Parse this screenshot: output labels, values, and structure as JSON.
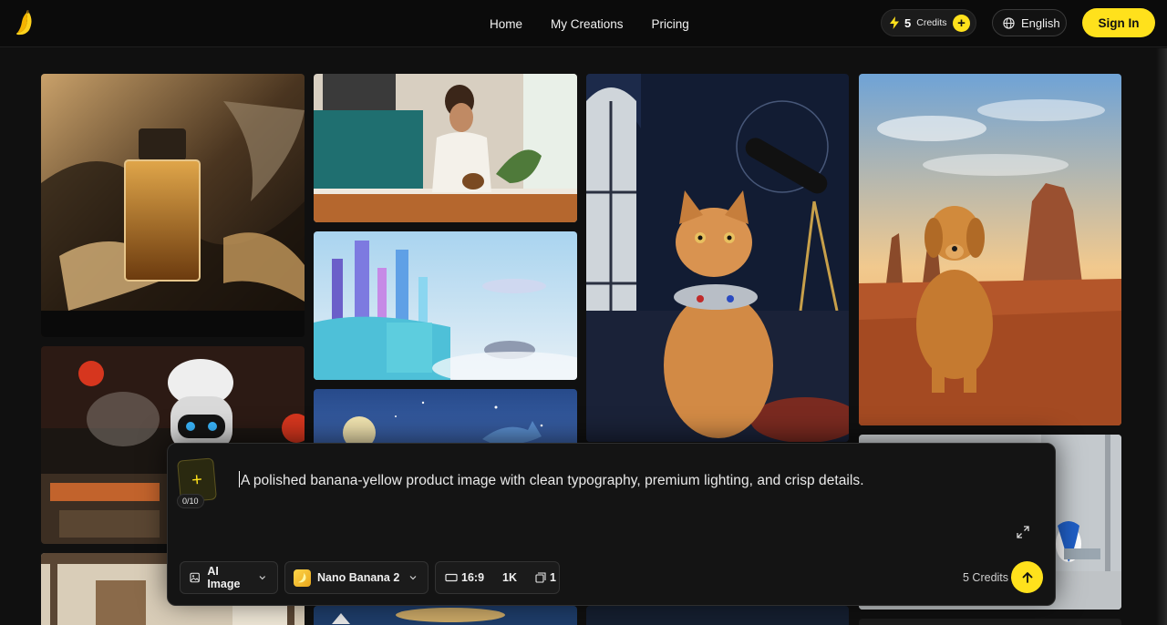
{
  "header": {
    "nav": [
      {
        "label": "Home"
      },
      {
        "label": "My Creations"
      },
      {
        "label": "Pricing"
      }
    ],
    "credits": {
      "count": "5",
      "label": "Credits"
    },
    "language": "English",
    "sign_in": "Sign In"
  },
  "gallery": {
    "tiles": [
      "perfume-bottle",
      "woman-pouring-coffee",
      "fantasy-sky-city",
      "cat-with-telescope",
      "golden-retriever-desert",
      "robot-chef",
      "moon-whale-night",
      "bathroom-interior",
      "japanese-room",
      "ocean-sunset",
      "dark-room",
      "dark-tile"
    ]
  },
  "composer": {
    "prompt": "A polished banana-yellow product image with clean typography, premium lighting, and crisp details.",
    "upload_count": "0/10",
    "type_label": "AI Image",
    "model_label": "Nano Banana 2",
    "aspect_ratio": "16:9",
    "resolution": "1K",
    "image_count": "1",
    "cost": "5 Credits"
  },
  "colors": {
    "accent": "#ffe11c",
    "background": "#101010",
    "panel": "#141414"
  }
}
